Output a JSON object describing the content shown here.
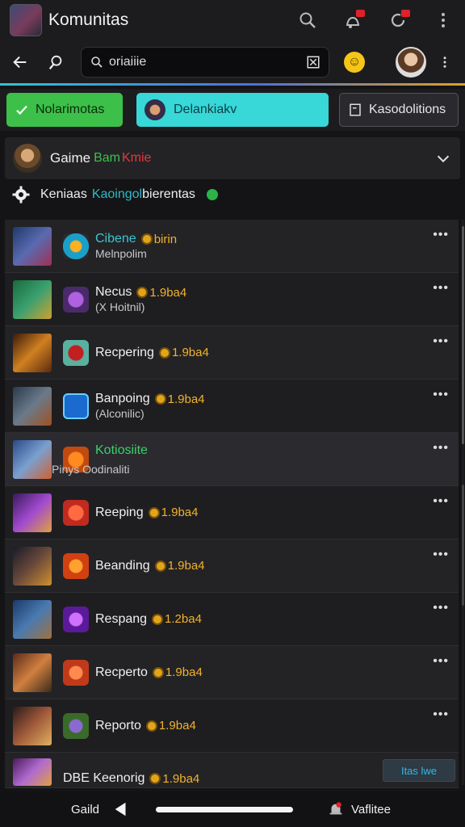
{
  "app": {
    "title": "Komunitas"
  },
  "search": {
    "value": "oriaiiie"
  },
  "tabs": [
    {
      "label": "Nolarimotas"
    },
    {
      "label": "Delankiakv"
    },
    {
      "label": "Kasodolitions"
    }
  ],
  "game": {
    "title": "Gaime",
    "green_text": "Bam",
    "red_text": "Kmie"
  },
  "settings": {
    "text1": "Keniaas",
    "text2": "Kaoingol",
    "text3": "bierentas"
  },
  "rows": [
    {
      "name": "Cibene",
      "sub": "Melnpolim",
      "value": "birin"
    },
    {
      "name": "Necus",
      "sub": "(X Hoitnil)",
      "value": "1.9ba4"
    },
    {
      "name": "Recpering",
      "sub": "",
      "value": "1.9ba4"
    },
    {
      "name": "Banpoing",
      "sub": "(Alconilic)",
      "value": "1.9ba4"
    },
    {
      "name": "Kotiosiite",
      "sub": "Pinys Oodinaliti",
      "value": ""
    },
    {
      "name": "Reeping",
      "sub": "",
      "value": "1.9ba4"
    },
    {
      "name": "Beanding",
      "sub": "",
      "value": "1.9ba4"
    },
    {
      "name": "Respang",
      "sub": "",
      "value": "1.2ba4"
    },
    {
      "name": "Recperto",
      "sub": "",
      "value": "1.9ba4"
    },
    {
      "name": "Reporto",
      "sub": "",
      "value": "1.9ba4"
    },
    {
      "name": "DBE Keenorig",
      "sub": "",
      "value": "1.9ba4"
    }
  ],
  "tag_button": {
    "label": "Itas lwe"
  },
  "bottom_nav": {
    "left_label": "Gaild",
    "right_label": "Vaflitee"
  },
  "colors": {
    "green": "#3cc049",
    "cyan": "#38d7d8",
    "coin": "#f2b22a"
  }
}
